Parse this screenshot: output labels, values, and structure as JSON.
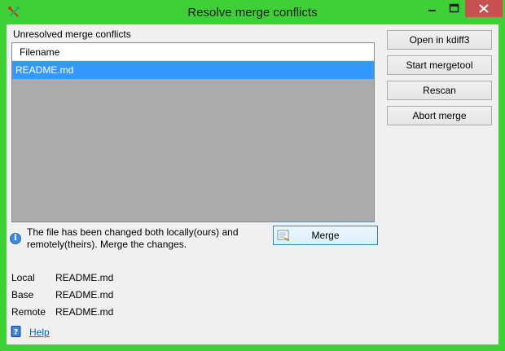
{
  "window": {
    "title": "Resolve merge conflicts"
  },
  "list": {
    "label": "Unresolved merge conflicts",
    "column": "Filename",
    "rows": [
      "README.md"
    ]
  },
  "actions": {
    "open_kdiff3": "Open in kdiff3",
    "start_mergetool": "Start mergetool",
    "rescan": "Rescan",
    "abort_merge": "Abort merge"
  },
  "info": {
    "message": "The file has been changed both locally(ours) and remotely(theirs). Merge the changes."
  },
  "merge_button": "Merge",
  "details": {
    "local_label": "Local",
    "local_value": "README.md",
    "base_label": "Base",
    "base_value": "README.md",
    "remote_label": "Remote",
    "remote_value": "README.md"
  },
  "help": "Help",
  "colors": {
    "frame": "#3fd038",
    "selection": "#3399ff",
    "close": "#c75050"
  }
}
